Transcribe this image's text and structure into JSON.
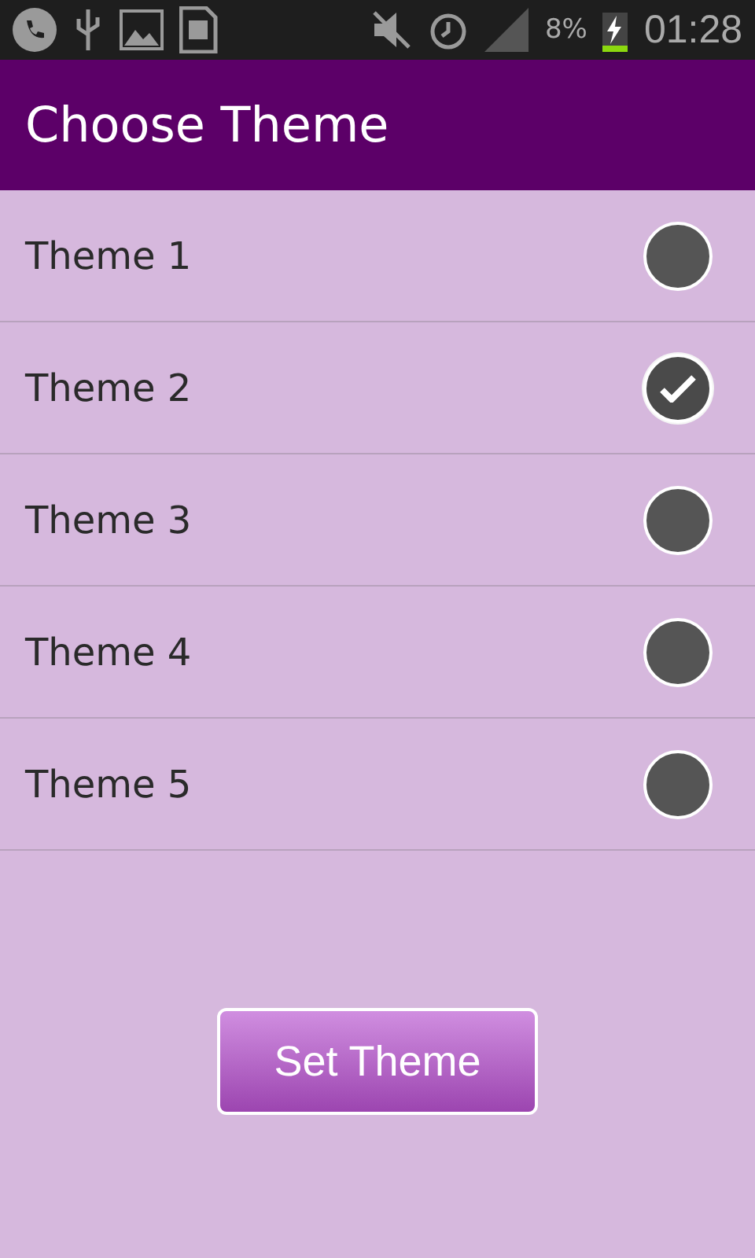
{
  "status_bar": {
    "battery": "8%",
    "time": "01:28"
  },
  "title": "Choose Theme",
  "themes": [
    {
      "label": "Theme 1",
      "selected": false
    },
    {
      "label": "Theme 2",
      "selected": true
    },
    {
      "label": "Theme 3",
      "selected": false
    },
    {
      "label": "Theme 4",
      "selected": false
    },
    {
      "label": "Theme 5",
      "selected": false
    }
  ],
  "button": "Set Theme"
}
